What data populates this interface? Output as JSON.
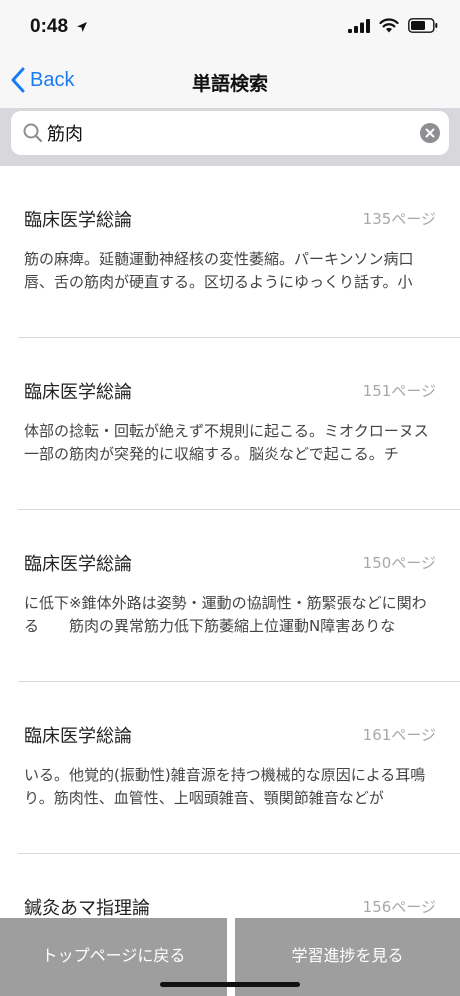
{
  "status": {
    "time": "0:48"
  },
  "nav": {
    "back_label": "Back",
    "title": "単語検索"
  },
  "search": {
    "value": "筋肉"
  },
  "results": [
    {
      "title": "臨床医学総論",
      "page": "135ページ",
      "snippet": "筋の麻痺。延髄運動神経核の変性萎縮。パーキンソン病口唇、舌の筋肉が硬直する。区切るようにゆっくり話す。小"
    },
    {
      "title": "臨床医学総論",
      "page": "151ページ",
      "snippet": "体部の捻転・回転が絶えず不規則に起こる。ミオクローヌス一部の筋肉が突発的に収縮する。脳炎などで起こる。チ"
    },
    {
      "title": "臨床医学総論",
      "page": "150ページ",
      "snippet": "に低下※錐体外路は姿勢・運動の協調性・筋緊張などに関わる　　筋肉の異常筋力低下筋萎縮上位運動N障害ありな"
    },
    {
      "title": "臨床医学総論",
      "page": "161ページ",
      "snippet": "いる。他覚的(振動性)雑音源を持つ機械的な原因による耳鳴り。筋肉性、血管性、上咽頭雑音、顎関節雑音などが"
    },
    {
      "title": "鍼灸あマ指理論",
      "page": "156ページ",
      "snippet": ""
    }
  ],
  "bottom": {
    "left_label": "トップページに戻る",
    "right_label": "学習進捗を見る"
  }
}
